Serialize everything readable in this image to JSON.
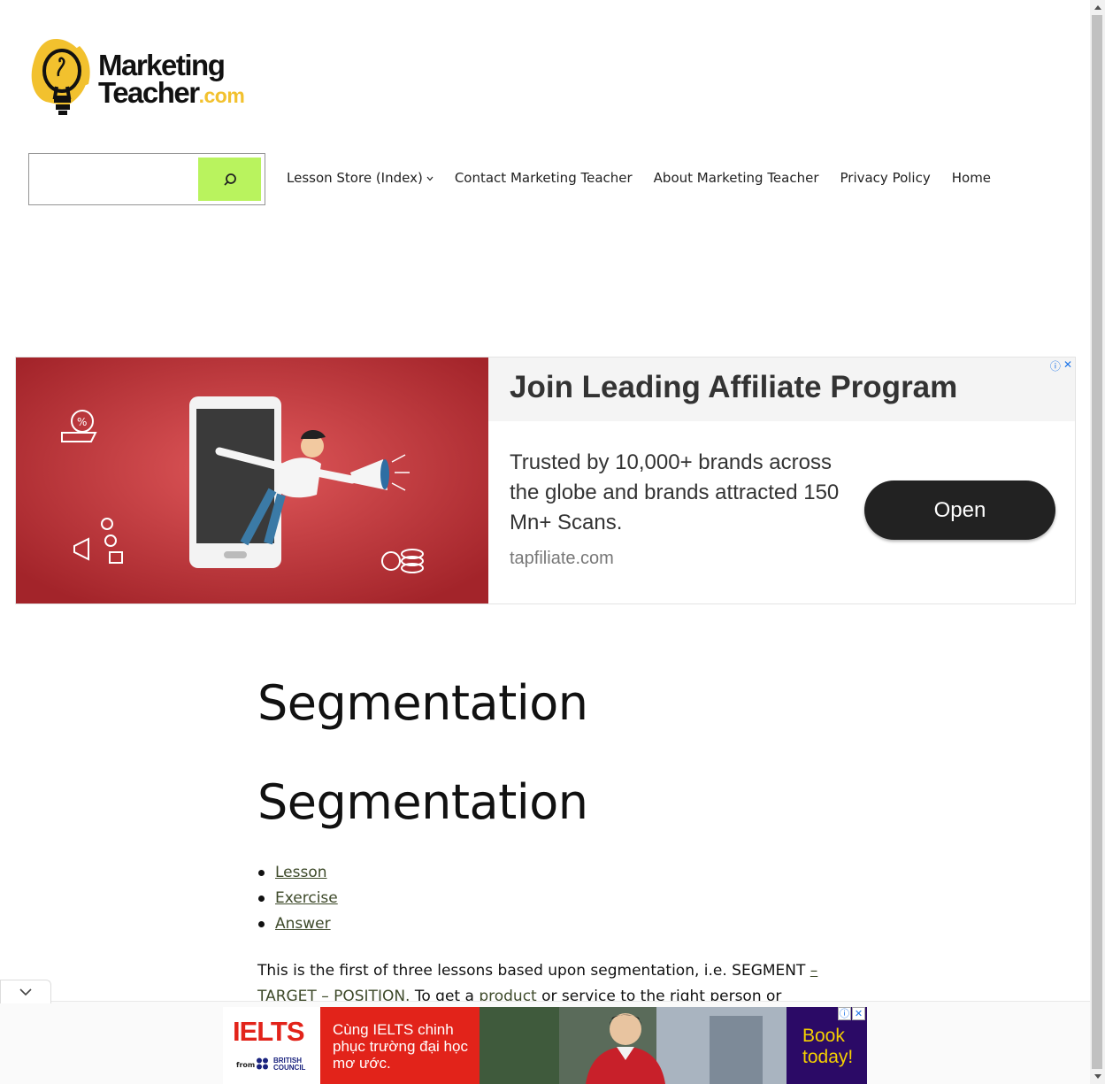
{
  "site": {
    "logo_line1": "Marketing",
    "logo_line2": "Teacher",
    "logo_dotcom": ".com",
    "accent_yellow": "#f2c12e",
    "search_button_color": "#b9f35e"
  },
  "search": {
    "value": "",
    "placeholder": ""
  },
  "nav": {
    "items": [
      {
        "label": "Lesson Store (Index)",
        "has_dropdown": true
      },
      {
        "label": "Contact Marketing Teacher"
      },
      {
        "label": "About Marketing Teacher"
      },
      {
        "label": "Privacy Policy"
      },
      {
        "label": "Home"
      }
    ]
  },
  "ad_banner": {
    "headline": "Join Leading Affiliate Program",
    "body": "Trusted by 10,000+ brands across the globe and brands attracted 150 Mn+ Scans.",
    "url": "tapfiliate.com",
    "cta": "Open",
    "info_icon": "ⓘ",
    "close_icon": "✕"
  },
  "article": {
    "title_1": "Segmentation",
    "title_2": "Segmentation",
    "links": [
      "Lesson",
      "Exercise",
      "Answer"
    ],
    "para_text_1": "This is the first of three lessons based upon segmentation, i.e. SEGMENT ",
    "para_link_1": "–",
    "para_link_2": "TARGET",
    "para_text_2": " ",
    "para_link_3": "– POSITION.",
    "para_text_3": " To get a ",
    "para_link_4": "product",
    "para_text_4": " or service to the right person or company,"
  },
  "bottom_ad": {
    "brand": "IELTS",
    "from": "from",
    "partner_line1": "BRITISH",
    "partner_line2": "COUNCIL",
    "tagline": "Cùng IELTS chinh phục trường đại học mơ ước.",
    "cta": "Book today!",
    "info_icon": "ⓘ",
    "close_icon": "✕"
  }
}
